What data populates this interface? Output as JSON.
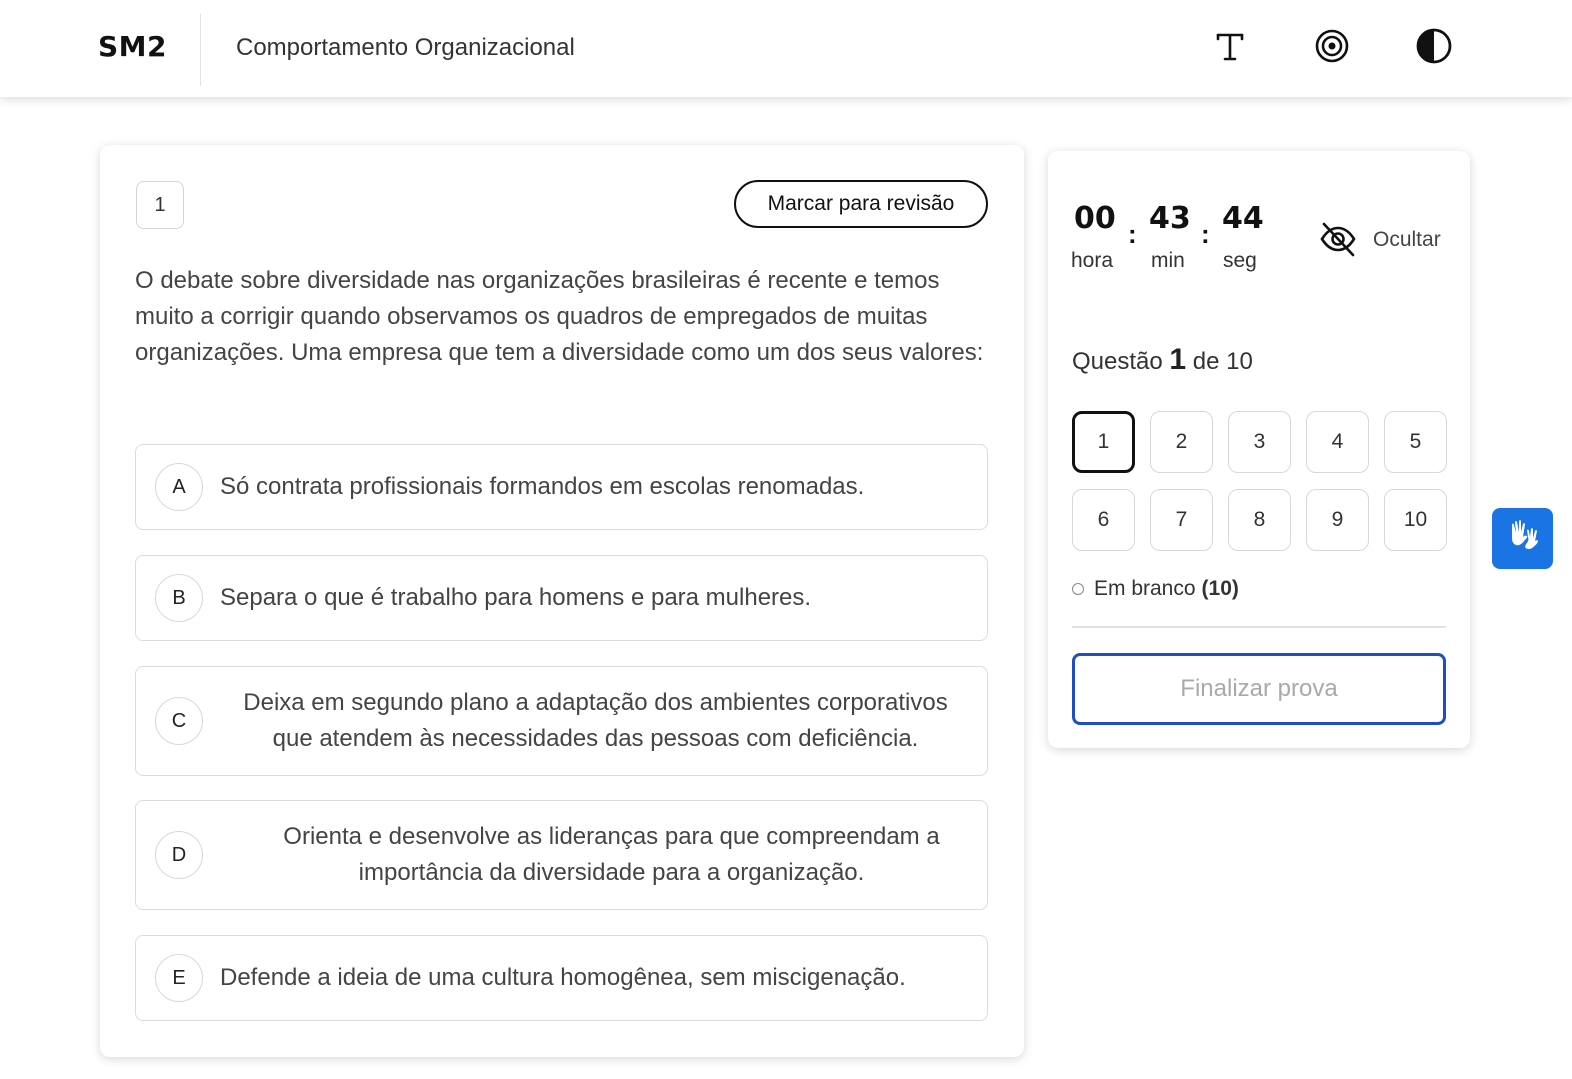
{
  "header": {
    "logo": "SM2",
    "course_title": "Comportamento Organizacional",
    "icons": [
      "text-size-icon",
      "focus-target-icon",
      "contrast-icon"
    ]
  },
  "question": {
    "number": "1",
    "review_label": "Marcar para revisão",
    "text": "O debate sobre diversidade nas organizações brasileiras é recente e temos muito a corrigir quando observamos os quadros de empregados de muitas organizações. Uma empresa que tem a diversidade como um dos seus valores:",
    "options": [
      {
        "letter": "A",
        "text": "Só contrata profissionais formandos em escolas renomadas."
      },
      {
        "letter": "B",
        "text": "Separa o que é trabalho para homens e para mulheres."
      },
      {
        "letter": "C",
        "text": "Deixa em segundo plano a adaptação dos ambientes corporativos que atendem às necessidades das pessoas com deficiência."
      },
      {
        "letter": "D",
        "text": "Orienta e desenvolve as lideranças para que compreendam a importância da diversidade para a organização."
      },
      {
        "letter": "E",
        "text": "Defende a ideia de uma cultura homogênea, sem miscigenação."
      }
    ]
  },
  "timer": {
    "hours": "00",
    "minutes": "43",
    "seconds": "44",
    "hours_label": "hora",
    "minutes_label": "min",
    "seconds_label": "seg",
    "separator": ":",
    "hide_label": "Ocultar"
  },
  "progress": {
    "prefix": "Questão",
    "current": "1",
    "suffix": "de 10",
    "questions": [
      "1",
      "2",
      "3",
      "4",
      "5",
      "6",
      "7",
      "8",
      "9",
      "10"
    ],
    "active_index": 0,
    "blank_label": "Em branco",
    "blank_count": "(10)"
  },
  "finish_label": "Finalizar prova",
  "colors": {
    "accent_blue": "#1e4fc2",
    "accessibility_blue": "#1b74e4"
  }
}
